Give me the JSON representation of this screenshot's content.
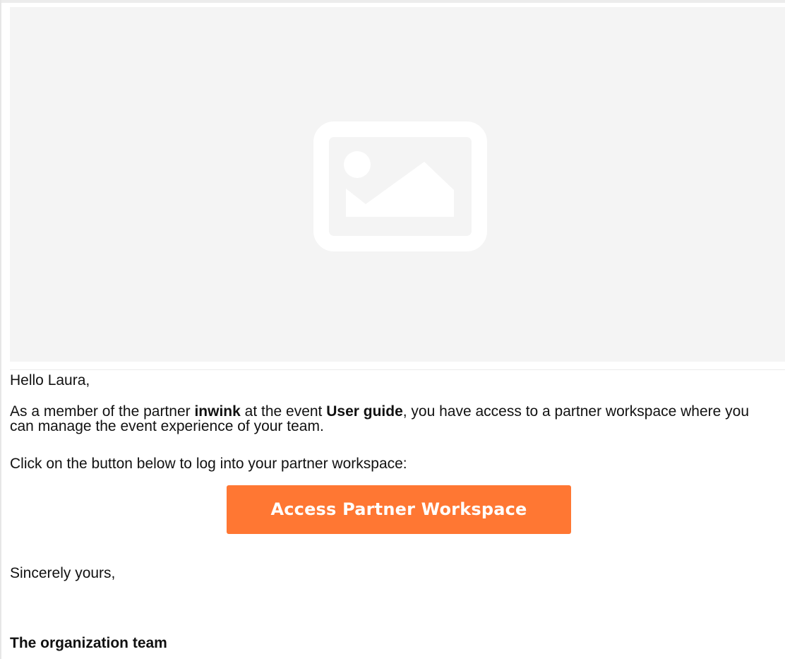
{
  "banner": {
    "image_icon": "image-placeholder-icon"
  },
  "email": {
    "greeting": "Hello Laura,",
    "intro": {
      "part1": "As a member of the partner ",
      "partner_name": "inwink",
      "part2": " at the event ",
      "event_name": "User guide",
      "part3": ", you have access to a partner workspace where you can manage the event experience of your team."
    },
    "instruction": "Click on the button below to log into your partner workspace:",
    "cta_label": "Access Partner Workspace",
    "closing": "Sincerely yours,",
    "signature": "The organization team"
  },
  "colors": {
    "accent": "#ff7733",
    "banner_bg": "#f4f4f4",
    "icon": "#ffffff"
  }
}
